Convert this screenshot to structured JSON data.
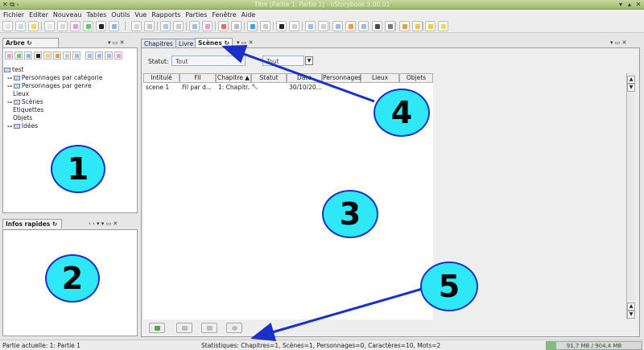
{
  "window": {
    "title": "Titre [Partie 1: Partie 1] - oStorybook 5.00.01",
    "ctrl_left": "✕ ⧉ -"
  },
  "menu": [
    "Fichier",
    "Editer",
    "Nouveau",
    "Tables",
    "Outils",
    "Vue",
    "Rapports",
    "Parties",
    "Fenêtre",
    "Aide"
  ],
  "toolbar": {
    "icon_colors": [
      "#e3e3e3",
      "#c9d7ea",
      "#f3d26b",
      "#e8e8e8",
      "#d8d8d8",
      "#e89ad6",
      "#5ec96b",
      "#222222",
      "#88b6e8",
      "#d6d6d6",
      "#c5c5c5",
      "#b6c4dc",
      "#c9c9c9",
      "#9dbbe3",
      "#e89ad6",
      "#e26b6b",
      "#bbbbbb",
      "#3da2e3",
      "#c9c9c9",
      "#222222",
      "#cfcfcf",
      "#9dbbe3",
      "#cfcfcf",
      "#9dbbe3",
      "#e89a4b",
      "#9dbbe3",
      "#4a4a4a",
      "#7a7a7a",
      "#e2a13a",
      "#f2c84b",
      "#f2c84b",
      "#f6d84b"
    ]
  },
  "tree_panel": {
    "title": "Arbre",
    "items": [
      {
        "label": "test",
        "level": 0,
        "folder": true
      },
      {
        "label": "Personnages par catégorie",
        "level": 1,
        "folder": true
      },
      {
        "label": "Personnages par genre",
        "level": 1,
        "folder": true
      },
      {
        "label": "Lieux",
        "level": 1,
        "folder": false
      },
      {
        "label": "Scènes",
        "level": 1,
        "folder": true
      },
      {
        "label": "Etiquettes",
        "level": 1,
        "folder": false
      },
      {
        "label": "Objets",
        "level": 1,
        "folder": false
      },
      {
        "label": "Idées",
        "level": 1,
        "folder": true
      }
    ]
  },
  "info_panel": {
    "title": "Infos rapides"
  },
  "tabs": [
    {
      "label": "Chapitres",
      "active": false
    },
    {
      "label": "Livre",
      "active": false
    },
    {
      "label": "Scènes",
      "active": true
    }
  ],
  "filter": {
    "status_label": "Statut:",
    "status_value": "Tout",
    "part_value": "Tout"
  },
  "table": {
    "columns": [
      "Intitulé",
      "Fil",
      "Chapitre ▲",
      "Statut",
      "Date",
      "Personnages",
      "Lieux",
      "Objets"
    ],
    "rows": [
      [
        "scene 1",
        "Fil par d...",
        "1: Chapitr...",
        "",
        "30/10/20...",
        "",
        "",
        ""
      ]
    ]
  },
  "statusbar": {
    "left": "Partie actuelle: 1: Partie 1",
    "center": "Statistiques: Chapitres=1,  Scènes=1,  Personnages=0,  Caractères=10,  Mots=2",
    "memory": "91,7 MB / 904,4 MB",
    "memory_fraction": 0.1
  },
  "annotations": [
    "1",
    "2",
    "3",
    "4",
    "5"
  ]
}
